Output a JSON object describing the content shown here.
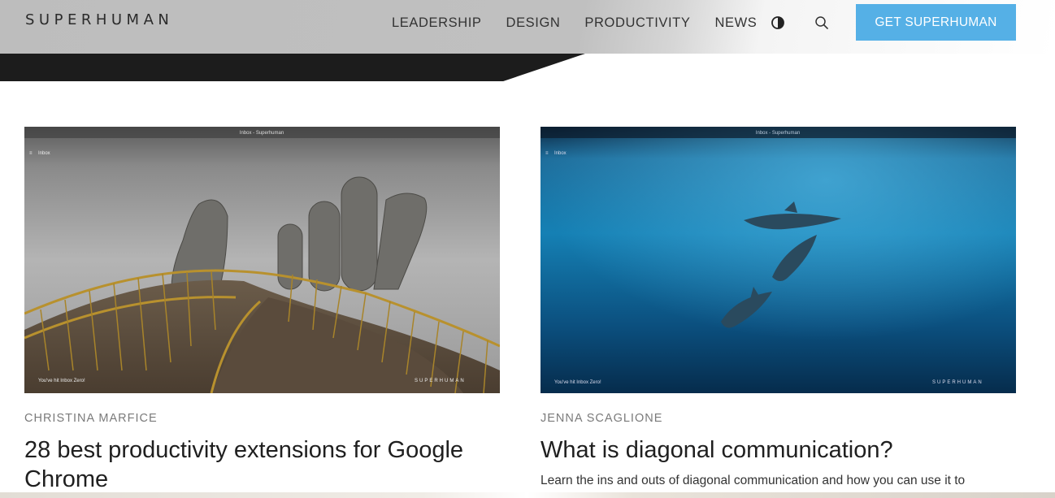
{
  "header": {
    "logo": "SUPERHUMAN",
    "nav": [
      "LEADERSHIP",
      "DESIGN",
      "PRODUCTIVITY",
      "NEWS"
    ],
    "icons": [
      "contrast-toggle-icon",
      "search-icon"
    ],
    "cta_label": "GET SUPERHUMAN",
    "cta_color": "#55b0e6"
  },
  "cards": [
    {
      "author": "CHRISTINA MARFICE",
      "title": "28 best productivity extensions for Google Chrome",
      "image": {
        "window_title": "Inbox - Superhuman",
        "inbox_label": "Inbox",
        "footer_left": "You've hit Inbox Zero!",
        "footer_brand": "SUPERHUMAN"
      }
    },
    {
      "author": "JENNA SCAGLIONE",
      "title": "What is diagonal communication?",
      "excerpt": "Learn the ins and outs of diagonal communication and how you can use it to",
      "image": {
        "window_title": "Inbox - Superhuman",
        "inbox_label": "Inbox",
        "footer_left": "You've hit Inbox Zero!",
        "footer_brand": "SUPERHUMAN"
      }
    }
  ]
}
